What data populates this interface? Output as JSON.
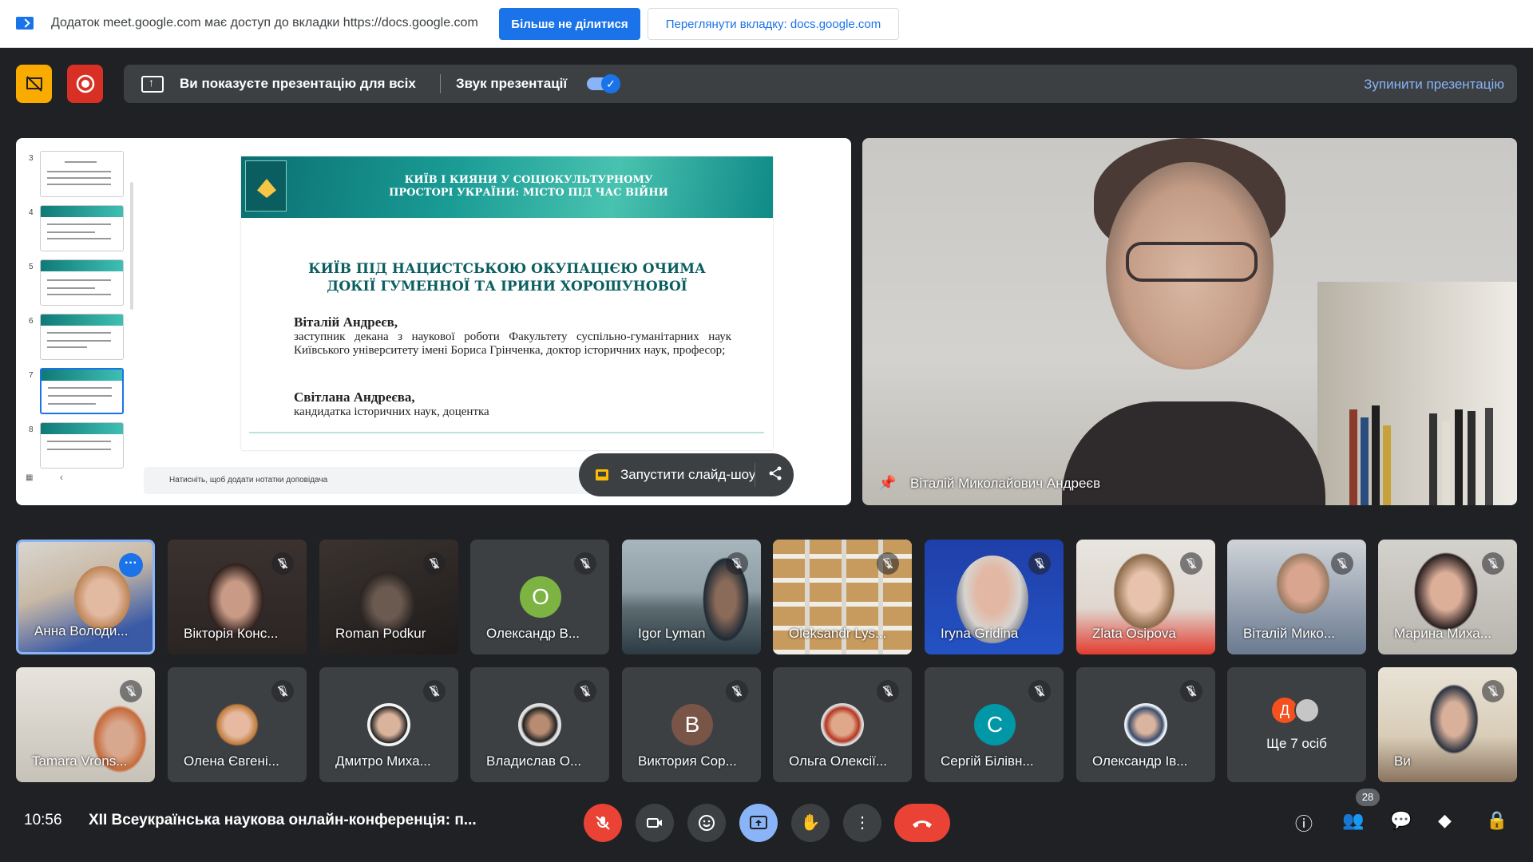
{
  "share_bar": {
    "message": "Додаток meet.google.com має доступ до вкладки https://docs.google.com",
    "stop_sharing": "Більше не ділитися",
    "view_tab": "Переглянути вкладку: docs.google.com"
  },
  "present_bar": {
    "status": "Ви показуєте презентацію для всіх",
    "sound_label": "Звук презентації",
    "sound_on": true,
    "stop": "Зупинити презентацію"
  },
  "slides": {
    "thumbnail_numbers": [
      "3",
      "4",
      "5",
      "6",
      "7",
      "8"
    ],
    "selected": "7",
    "banner_title": "КИЇВ І КИЯНИ У СОЦІОКУЛЬТУРНОМУ\nПРОСТОРІ УКРАЇНИ: МІСТО ПІД ЧАС ВІЙНИ",
    "title": "КИЇВ ПІД НАЦИСТСЬКОЮ ОКУПАЦІЄЮ ОЧИМА\nДОКІЇ ГУМЕННОЇ ТА ІРИНИ ХОРОШУНОВОЇ",
    "author1_name": "Віталій Андреєв,",
    "author1_desc": "заступник декана з наукової роботи Факультету суспільно-гуманітарних наук Київського університету імені Бориса Грінченка, доктор історичних наук, професор;",
    "author2_name": "Світлана Андреєва,",
    "author2_desc": "кандидатка історичних наук, доцентка",
    "notes_placeholder": "Натисніть, щоб додати нотатки доповідача",
    "slideshow_button": "Запустити слайд-шоу"
  },
  "main_video": {
    "name": "Віталій Миколайович Андреєв"
  },
  "participants_row1": [
    {
      "name": "Анна Володи...",
      "active": true
    },
    {
      "name": "Вікторія Конс..."
    },
    {
      "name": "Roman Podkur"
    },
    {
      "name": "Олександр В...",
      "letter": "О",
      "color": "#7cb342"
    },
    {
      "name": "Igor Lyman"
    },
    {
      "name": "Oleksandr Lys..."
    },
    {
      "name": "Iryna Gridina"
    },
    {
      "name": "Zlata Osipova"
    },
    {
      "name": "Віталій Мико..."
    },
    {
      "name": "Марина Миха..."
    }
  ],
  "participants_row2": [
    {
      "name": "Tamara Vrons..."
    },
    {
      "name": "Олена Євгені..."
    },
    {
      "name": "Дмитро Миха..."
    },
    {
      "name": "Владислав О..."
    },
    {
      "name": "Виктория Сор...",
      "letter": "В",
      "color": "#795548"
    },
    {
      "name": "Ольга Олексії..."
    },
    {
      "name": "Сергій Білівн...",
      "letter": "С",
      "color": "#0097a7"
    },
    {
      "name": "Олександр Ів..."
    },
    {
      "name": "Ще 7 осіб",
      "letter": "Д"
    },
    {
      "name": "Ви"
    }
  ],
  "bottom_bar": {
    "time": "10:56",
    "meeting_title": "XII Всеукраїнська наукова онлайн-конференція: п...",
    "people_count": "28"
  }
}
